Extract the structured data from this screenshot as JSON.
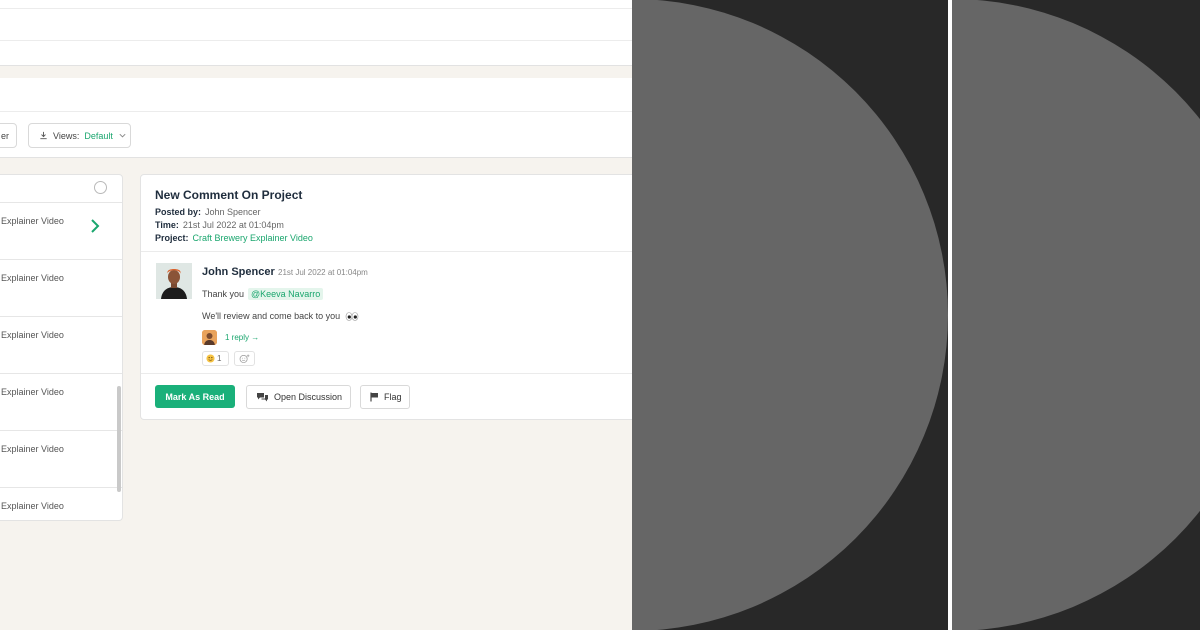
{
  "toolbar": {
    "filter_partial_label": "er",
    "views_label": "Views:",
    "views_value": "Default"
  },
  "list": {
    "items": [
      {
        "label": "ry Explainer Video"
      },
      {
        "label": "ry Explainer Video"
      },
      {
        "label": "ry Explainer Video"
      },
      {
        "label": "ry Explainer Video"
      },
      {
        "label": "ry Explainer Video"
      },
      {
        "label": "ry Explainer Video"
      }
    ]
  },
  "notification": {
    "title": "New Comment On Project",
    "posted_by_label": "Posted by:",
    "posted_by": "John Spencer",
    "time_label": "Time:",
    "time": "21st Jul 2022 at 01:04pm",
    "project_label": "Project:",
    "project": "Craft Brewery Explainer Video"
  },
  "comment": {
    "author": "John Spencer",
    "time": "21st Jul 2022 at 01:04pm",
    "text1": "Thank you",
    "mention": "@Keeva Navarro",
    "text2": "We'll review and come back to you",
    "reply_link": "1 reply",
    "reaction_count": "1"
  },
  "actions": {
    "mark_read": "Mark As Read",
    "open_discussion": "Open Discussion",
    "flag": "Flag"
  },
  "colors": {
    "accent": "#1ab07a",
    "panel_dark": "#282828",
    "circle_gray": "#666666"
  }
}
